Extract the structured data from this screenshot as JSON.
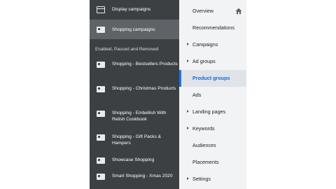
{
  "campaign_panel": {
    "items_top": [
      {
        "label": "Display campaigns",
        "icon": "display-campaign-icon"
      },
      {
        "label": "Shopping campaigns",
        "icon": "shopping-tag-icon"
      }
    ],
    "section_label": "Enabled, Paused and Removed",
    "campaigns": [
      {
        "label": "Shopping - Bestsellers Products",
        "icon": "shopping-tag-icon"
      },
      {
        "label": "Shopping - Christmas Products",
        "icon": "shopping-tag-icon"
      },
      {
        "label": "Shopping - Embellish With Relish Cookbook",
        "icon": "shopping-tag-icon"
      },
      {
        "label": "Shopping - Gift Packs & Hampers",
        "icon": "shopping-tag-icon"
      },
      {
        "label": "Showcase Shopping",
        "icon": "shopping-tag-icon"
      },
      {
        "label": "Smart Shopping - Xmas 2020",
        "icon": "shopping-tag-icon"
      }
    ]
  },
  "page_menu": {
    "items": [
      {
        "label": "Overview",
        "icon": "home-icon"
      },
      {
        "label": "Recommendations"
      },
      {
        "label": "Campaigns",
        "expandable": true
      },
      {
        "label": "Ad groups",
        "expandable": true
      },
      {
        "label": "Product groups",
        "active": true
      },
      {
        "label": "Ads"
      },
      {
        "label": "Landing pages",
        "expandable": true
      },
      {
        "label": "Keywords",
        "expandable": true
      },
      {
        "label": "Audiences"
      },
      {
        "label": "Placements"
      },
      {
        "label": "Settings",
        "expandable": true
      }
    ]
  },
  "colors": {
    "sidebar_bg": "#3c4043",
    "sidebar_selected_bg": "#5f6368",
    "menu_bg": "#f1f3f4",
    "active_accent": "#1a73e8"
  }
}
